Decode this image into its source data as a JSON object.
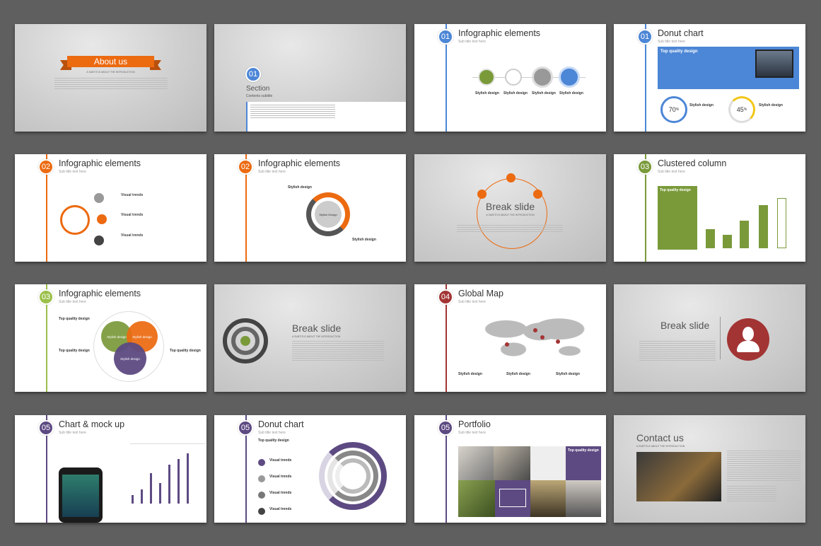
{
  "colors": {
    "blue": "#4c86d6",
    "orange": "#ec6a10",
    "green": "#7a9a3a",
    "red": "#a33434",
    "purple": "#5d4a82"
  },
  "slides": {
    "s1": {
      "title": "About us",
      "subtitle": "A SUBTITLE ABOUT THE INTRODUCTION"
    },
    "s2": {
      "num": "01",
      "title": "Section",
      "subtitle": "Contents subtitle"
    },
    "s3": {
      "num": "01",
      "title": "Infographic elements",
      "subtitle": "Sub title text here",
      "items": [
        "Stylish design",
        "Stylish design",
        "Stylish design",
        "Stylish design"
      ]
    },
    "s4": {
      "num": "01",
      "title": "Donut chart",
      "subtitle": "Sub title text here",
      "banner": "Top quality design",
      "p1": "70",
      "p2": "45",
      "unit": "%",
      "l1": "Stylish design",
      "l2": "Stylish design"
    },
    "s5": {
      "num": "02",
      "title": "Infographic elements",
      "subtitle": "Sub title text here",
      "items": [
        "Visual trends",
        "Visual trends",
        "Visual trends"
      ]
    },
    "s6": {
      "num": "02",
      "title": "Infographic elements",
      "subtitle": "Sub title text here",
      "l1": "Stylish design",
      "l2": "Stylish design",
      "center": "Stylish Design"
    },
    "s7": {
      "title": "Break slide",
      "subtitle": "A SUBTITLE ABOUT THE INTRODUCTION"
    },
    "s8": {
      "num": "03",
      "title": "Clustered column",
      "subtitle": "Sub title text here",
      "banner": "Top quality design"
    },
    "s9": {
      "num": "03",
      "title": "Infographic elements",
      "subtitle": "Sub title text here",
      "labels": [
        "Top quality design",
        "Top quality design",
        "Top quality design"
      ],
      "circles": [
        "Stylish design",
        "Stylish design",
        "Stylish design"
      ]
    },
    "s10": {
      "title": "Break slide",
      "subtitle": "A SUBTITLE ABOUT THE INTRODUCTION"
    },
    "s11": {
      "num": "04",
      "title": "Global Map",
      "subtitle": "Sub title text here",
      "items": [
        "Stylish design",
        "Stylish design",
        "Stylish design"
      ]
    },
    "s12": {
      "title": "Break slide"
    },
    "s13": {
      "num": "05",
      "title": "Chart & mock up",
      "subtitle": "Sub title text here"
    },
    "s14": {
      "num": "05",
      "title": "Donut chart",
      "subtitle": "Sub title text here",
      "banner": "Top quality design",
      "items": [
        "Visual trends",
        "Visual trends",
        "Visual trends",
        "Visual trends"
      ]
    },
    "s15": {
      "num": "05",
      "title": "Portfolio",
      "subtitle": "Sub title text here",
      "banner": "Top quality design"
    },
    "s16": {
      "title": "Contact us",
      "subtitle": "A SUBTITLE ABOUT THE INTRODUCTION"
    }
  }
}
